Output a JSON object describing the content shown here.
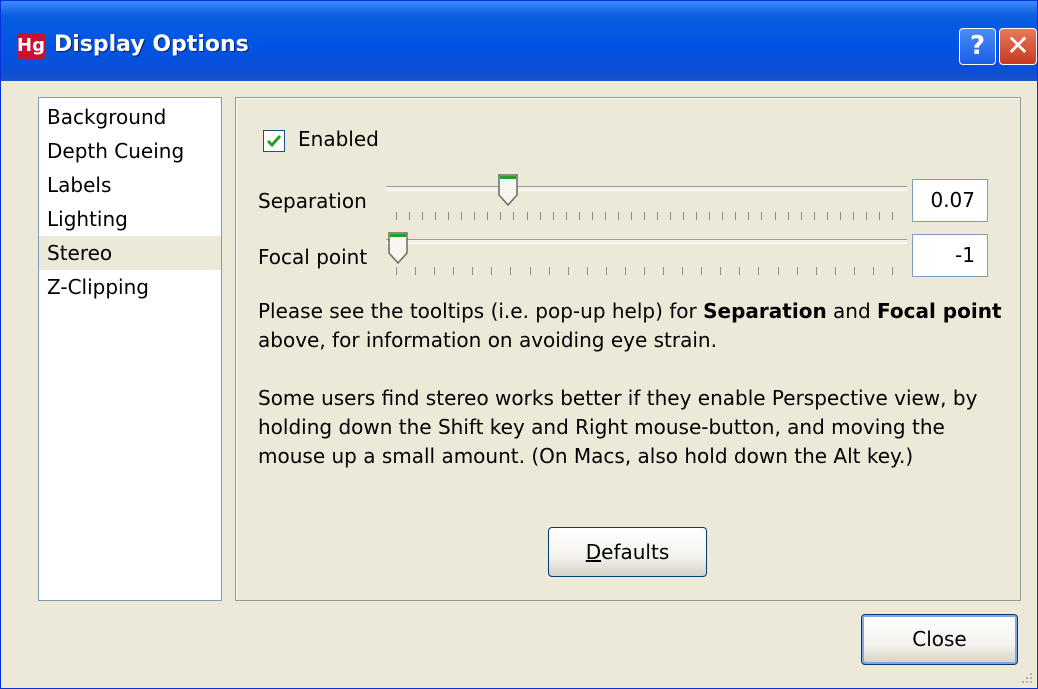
{
  "window": {
    "app_icon_text": "Hg",
    "title": "Display Options",
    "help_button": "?",
    "close_glyph": "✕"
  },
  "categories": {
    "items": [
      "Background",
      "Depth Cueing",
      "Labels",
      "Lighting",
      "Stereo",
      "Z-Clipping"
    ],
    "selected": "Stereo"
  },
  "stereo": {
    "enabled_label": "Enabled",
    "enabled_checked": true,
    "separation": {
      "label": "Separation",
      "value": "0.07",
      "slider_fraction": 0.22
    },
    "focal_point": {
      "label": "Focal point",
      "value": "-1",
      "slider_fraction": 0.0
    },
    "help1": {
      "pre": "Please see the tooltips (i.e. pop-up help) for ",
      "bold1": "Separation",
      "mid": " and ",
      "bold2": "Focal point",
      "post": " above, for information on avoiding eye strain."
    },
    "help2": "Some users find stereo works better if they enable Perspective view, by holding down the Shift key and Right mouse-button, and moving the mouse up a small amount. (On Macs, also hold down the Alt key.)",
    "defaults_button": {
      "mnemonic": "D",
      "rest": "efaults"
    }
  },
  "footer": {
    "close_button": "Close"
  },
  "colors": {
    "titlebar": "#0054e3",
    "dialog_bg": "#ece9d8",
    "close_red": "#c8391e",
    "thumb_green": "#21a121"
  }
}
